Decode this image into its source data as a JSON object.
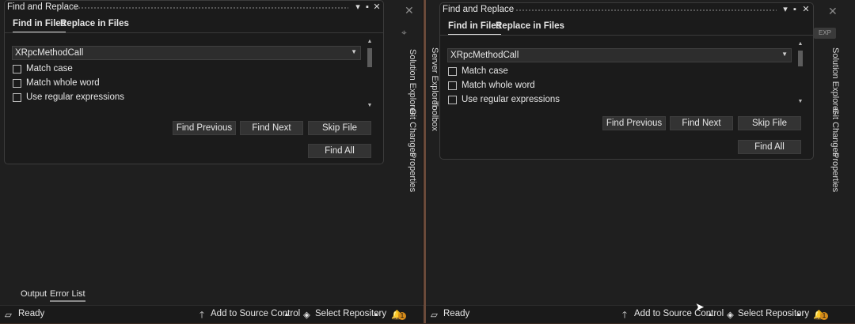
{
  "panes": [
    {
      "dialog": {
        "title": "Find and Replace",
        "tabs": [
          "Find in Files",
          "Replace in Files"
        ],
        "search_value": "XRpcMethodCall",
        "options": [
          "Match case",
          "Match whole word",
          "Use regular expressions"
        ],
        "buttons": {
          "find_previous": "Find Previous",
          "find_next": "Find Next",
          "skip_file": "Skip File",
          "find_all": "Find All"
        }
      },
      "side_tabs": [
        "Solution Explorer",
        "Git Changes",
        "Properties"
      ],
      "bottom_tabs": [
        "Output",
        "Error List"
      ],
      "status": {
        "ready": "Ready",
        "source_control": "Add to Source Control",
        "repository": "Select Repository",
        "notifications": "1"
      }
    },
    {
      "dialog": {
        "title": "Find and Replace",
        "tabs": [
          "Find in Files",
          "Replace in Files"
        ],
        "search_value": "XRpcMethodCall",
        "options": [
          "Match case",
          "Match whole word",
          "Use regular expressions"
        ],
        "buttons": {
          "find_previous": "Find Previous",
          "find_next": "Find Next",
          "skip_file": "Skip File",
          "find_all": "Find All"
        }
      },
      "left_tabs": [
        "Server Explorer",
        "Toolbox"
      ],
      "side_tabs": [
        "Solution Explorer",
        "Git Changes",
        "Properties"
      ],
      "exp_badge": "EXP",
      "status": {
        "ready": "Ready",
        "source_control": "Add to Source Control",
        "repository": "Select Repository",
        "notifications": "1"
      }
    }
  ],
  "icons": [
    "close-icon",
    "pin-icon",
    "maximize-icon",
    "caret-down-icon",
    "upload-arrow-icon",
    "repository-icon",
    "bell-icon",
    "window-icon"
  ]
}
